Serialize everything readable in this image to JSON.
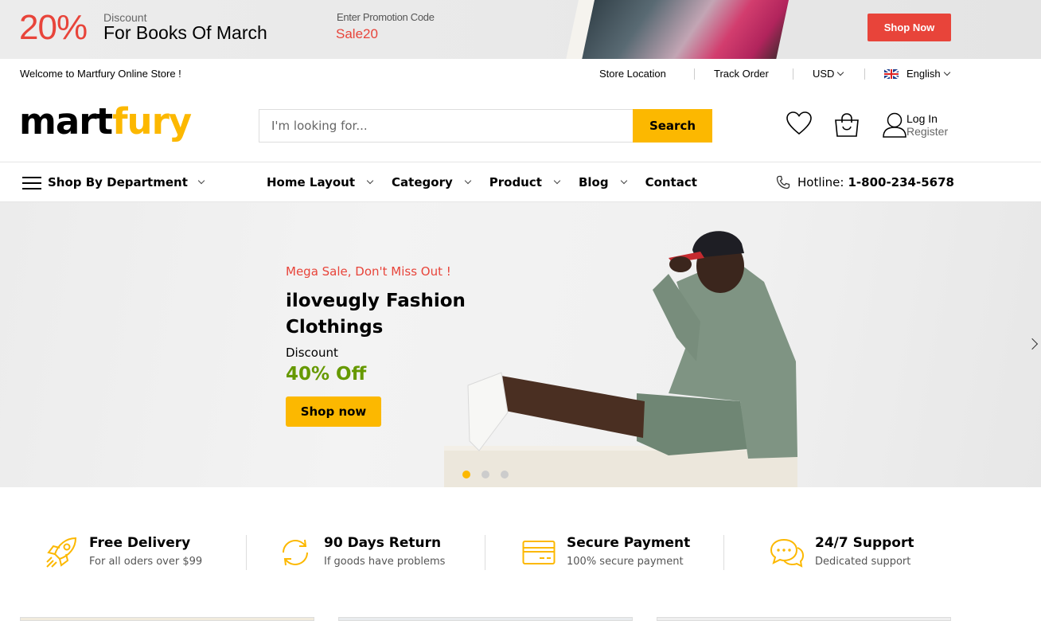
{
  "promo": {
    "percent": "20%",
    "discount_label": "Discount",
    "discount_title": "For Books Of March",
    "code_label": "Enter Promotion Code",
    "code": "Sale20",
    "shop_now": "Shop Now"
  },
  "topbar": {
    "welcome": "Welcome to Martfury Online Store !",
    "store_location": "Store Location",
    "track_order": "Track Order",
    "currency": "USD",
    "language": "English"
  },
  "header": {
    "logo_part1": "mart",
    "logo_part2": "fury",
    "search_placeholder": "I'm looking for...",
    "search_button": "Search",
    "login": "Log In",
    "register": "Register"
  },
  "nav": {
    "department": "Shop By Department",
    "items": [
      {
        "label": "Home Layout"
      },
      {
        "label": "Category"
      },
      {
        "label": "Product"
      },
      {
        "label": "Blog"
      },
      {
        "label": "Contact"
      }
    ],
    "hotline_label": "Hotline:",
    "hotline_number": "1-800-234-5678"
  },
  "hero": {
    "subtitle": "Mega Sale, Don't Miss Out !",
    "title": "iloveugly Fashion Clothings",
    "discount_label": "Discount",
    "discount_value": "40% Off",
    "button": "Shop now"
  },
  "features": [
    {
      "title": "Free Delivery",
      "subtitle": "For all oders over $99",
      "icon": "rocket-icon"
    },
    {
      "title": "90 Days Return",
      "subtitle": "If goods have problems",
      "icon": "refresh-icon"
    },
    {
      "title": "Secure Payment",
      "subtitle": "100% secure payment",
      "icon": "credit-card-icon"
    },
    {
      "title": "24/7 Support",
      "subtitle": "Dedicated support",
      "icon": "chat-icon"
    }
  ],
  "colors": {
    "brand": "#fcb800",
    "accent_red": "#e8443a",
    "green": "#669900"
  }
}
